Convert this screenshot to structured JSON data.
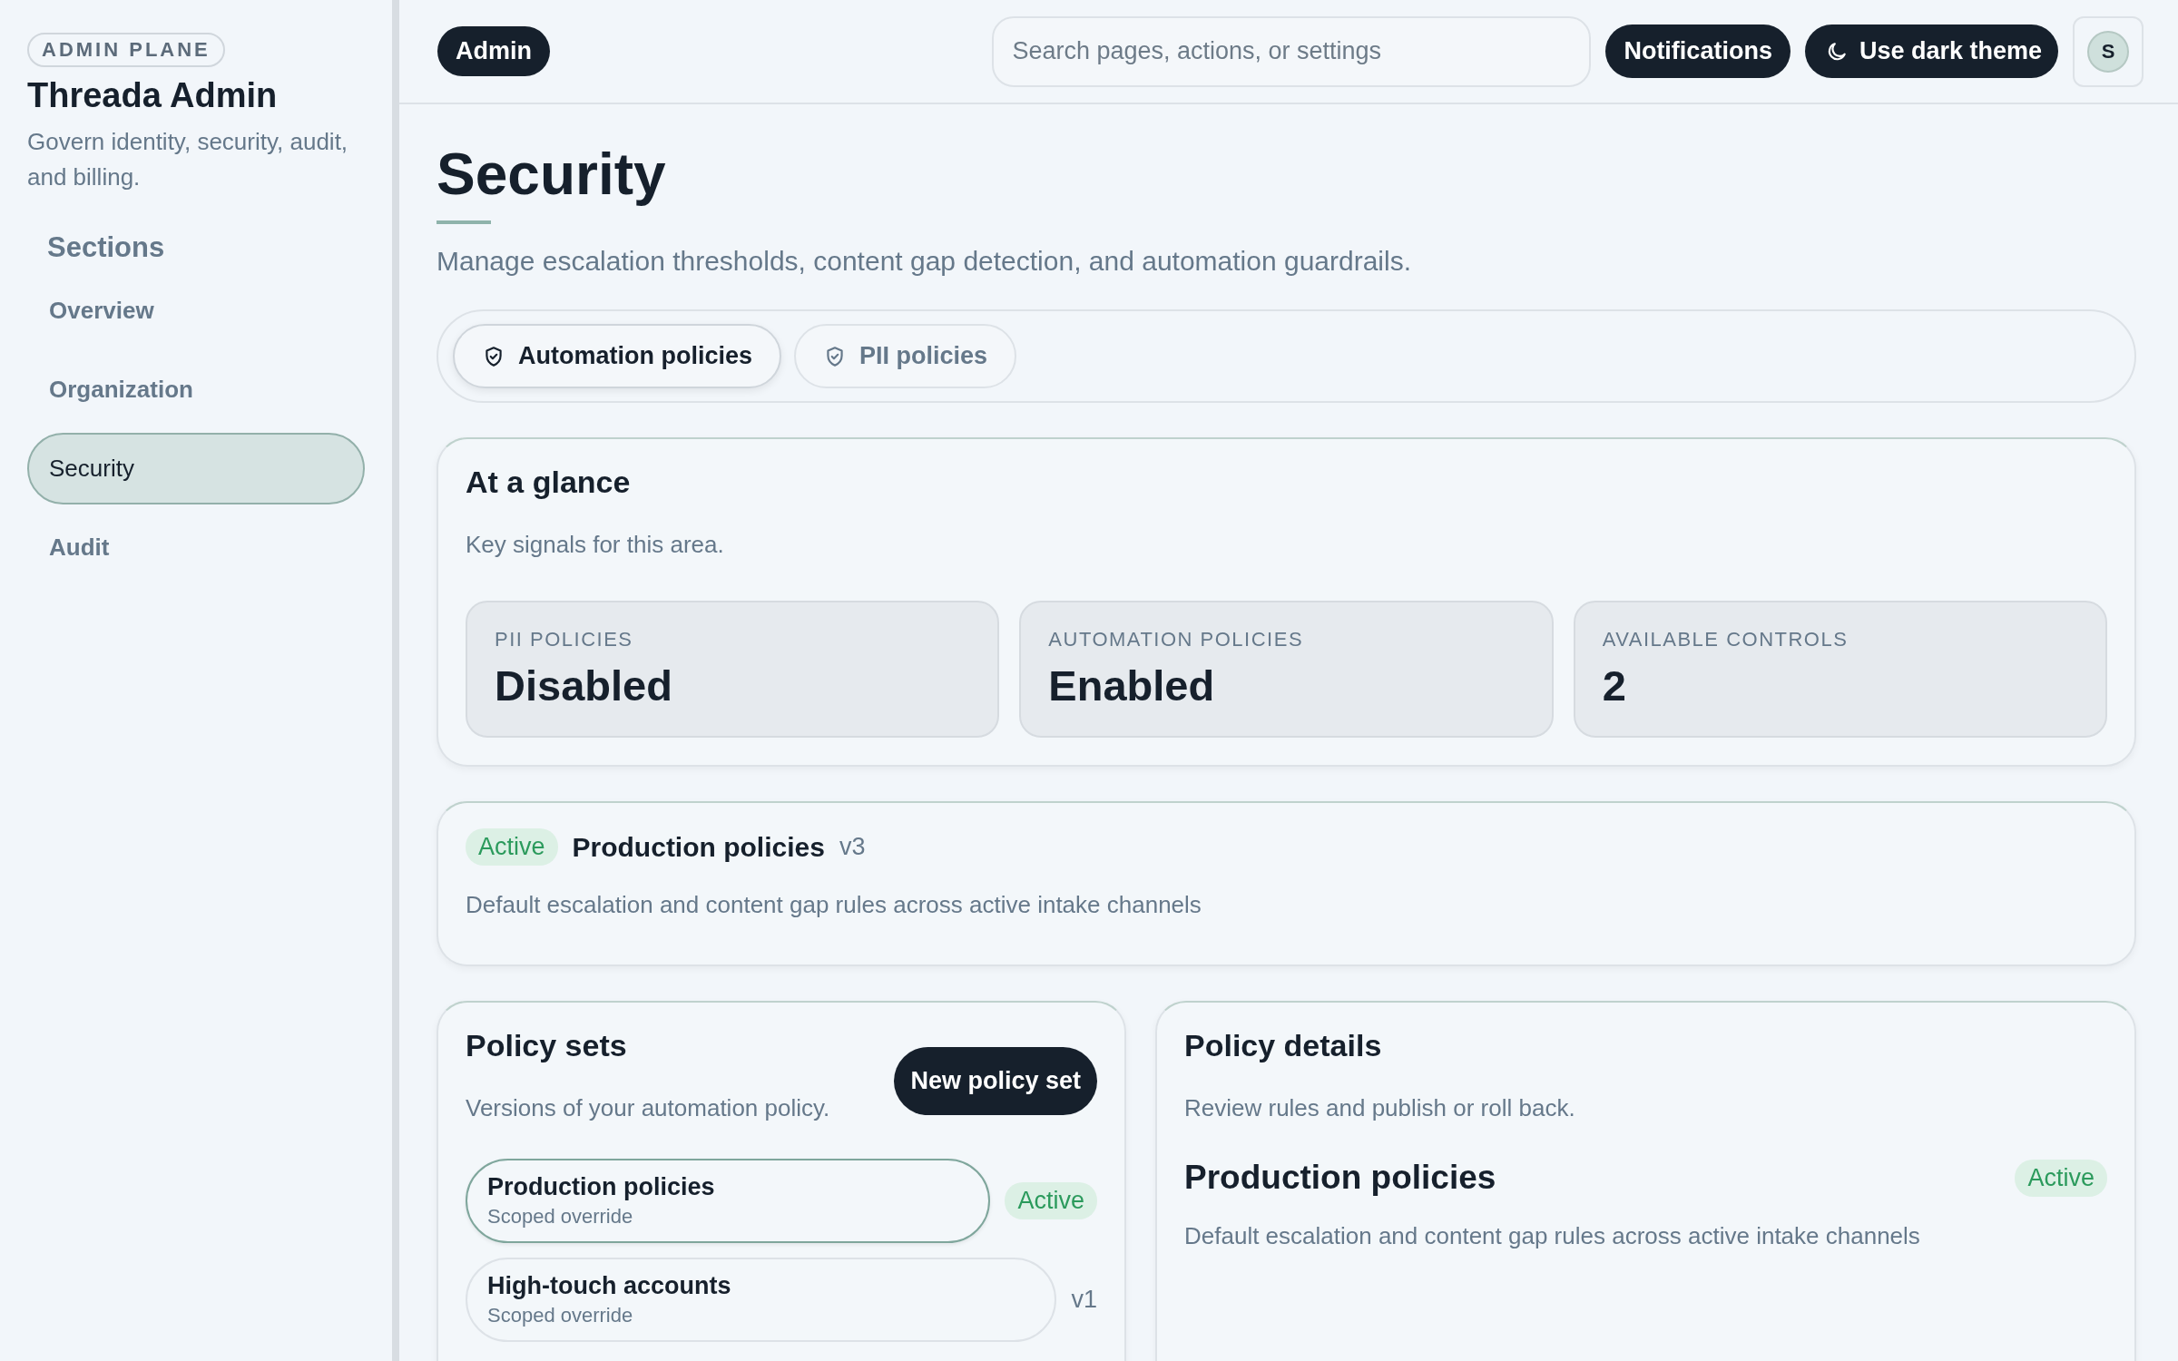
{
  "sidebar": {
    "badge": "ADMIN PLANE",
    "title": "Threada Admin",
    "subtitle": "Govern identity, security, audit, and billing.",
    "section_heading": "Sections",
    "items": [
      {
        "label": "Overview",
        "selected": false
      },
      {
        "label": "Organization",
        "selected": false
      },
      {
        "label": "Security",
        "selected": true
      },
      {
        "label": "Audit",
        "selected": false
      }
    ]
  },
  "header": {
    "role_badge": "Admin",
    "search": {
      "placeholder": "Search pages, actions, or settings"
    },
    "notifications_button": "Notifications",
    "theme_button": "Use dark theme",
    "avatar": "S"
  },
  "page": {
    "title": "Security",
    "description": "Manage escalation thresholds, content gap detection, and automation guardrails."
  },
  "tabs": [
    {
      "label": "Automation policies",
      "selected": true
    },
    {
      "label": "PII policies",
      "selected": false
    }
  ],
  "glance": {
    "title": "At a glance",
    "subtitle": "Key signals for this area.",
    "stats": [
      {
        "label": "PII POLICIES",
        "value": "Disabled"
      },
      {
        "label": "AUTOMATION POLICIES",
        "value": "Enabled"
      },
      {
        "label": "AVAILABLE CONTROLS",
        "value": "2"
      }
    ]
  },
  "active_policy": {
    "status": "Active",
    "name": "Production policies",
    "version": "v3",
    "description": "Default escalation and content gap rules across active intake channels"
  },
  "policy_sets": {
    "title": "Policy sets",
    "subtitle": "Versions of your automation policy.",
    "new_button": "New policy set",
    "items": [
      {
        "name": "Production policies",
        "subtitle": "Scoped override",
        "selected": true,
        "tag": {
          "kind": "status",
          "text": "Active"
        }
      },
      {
        "name": "High-touch accounts",
        "subtitle": "Scoped override",
        "selected": false,
        "tag": {
          "kind": "version",
          "text": "v1"
        }
      }
    ]
  },
  "policy_details": {
    "title": "Policy details",
    "subtitle": "Review rules and publish or roll back.",
    "name": "Production policies",
    "status": "Active",
    "description": "Default escalation and content gap rules across active intake channels"
  }
}
